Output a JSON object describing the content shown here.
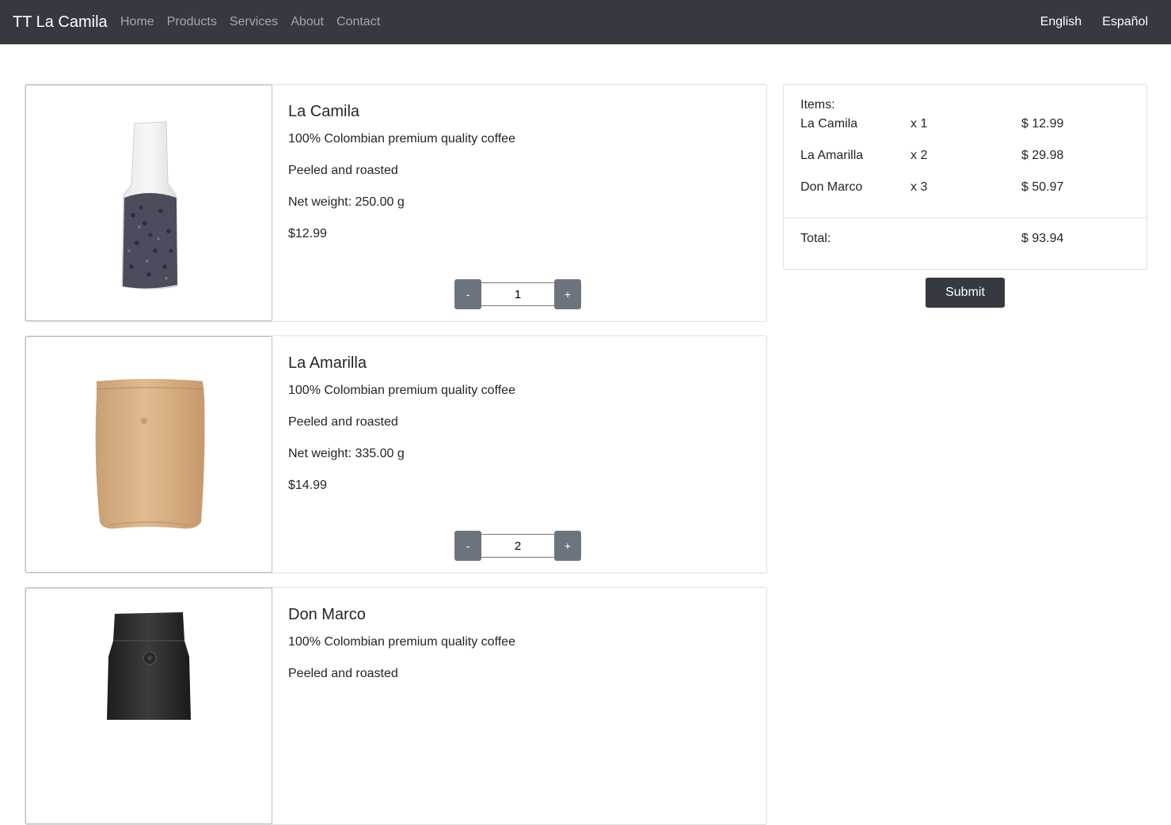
{
  "navbar": {
    "brand": "TT La Camila",
    "links": [
      "Home",
      "Products",
      "Services",
      "About",
      "Contact"
    ],
    "languages": [
      "English",
      "Español"
    ]
  },
  "products": [
    {
      "name": "La Camila",
      "description": "100% Colombian premium quality coffee",
      "process": "Peeled and roasted",
      "weight": "Net weight: 250.00 g",
      "price": "$12.99",
      "quantity": "1",
      "image": "clear-coffee-bag"
    },
    {
      "name": "La Amarilla",
      "description": "100% Colombian premium quality coffee",
      "process": "Peeled and roasted",
      "weight": "Net weight: 335.00 g",
      "price": "$14.99",
      "quantity": "2",
      "image": "kraft-coffee-bag"
    },
    {
      "name": "Don Marco",
      "description": "100% Colombian premium quality coffee",
      "process": "Peeled and roasted",
      "weight": "",
      "price": "",
      "quantity": "",
      "image": "black-coffee-bag"
    }
  ],
  "quantity_controls": {
    "minus": "-",
    "plus": "+"
  },
  "summary": {
    "items_label": "Items:",
    "items": [
      {
        "name": "La Camila",
        "qty": "x 1",
        "amount": "$ 12.99"
      },
      {
        "name": "La Amarilla",
        "qty": "x 2",
        "amount": "$ 29.98"
      },
      {
        "name": "Don Marco",
        "qty": "x 3",
        "amount": "$ 50.97"
      }
    ],
    "total_label": "Total:",
    "total_amount": "$ 93.94"
  },
  "submit_label": "Submit",
  "colors": {
    "navbar_bg": "#343a40",
    "button_secondary": "#6c757d",
    "button_dark": "#343a40"
  }
}
